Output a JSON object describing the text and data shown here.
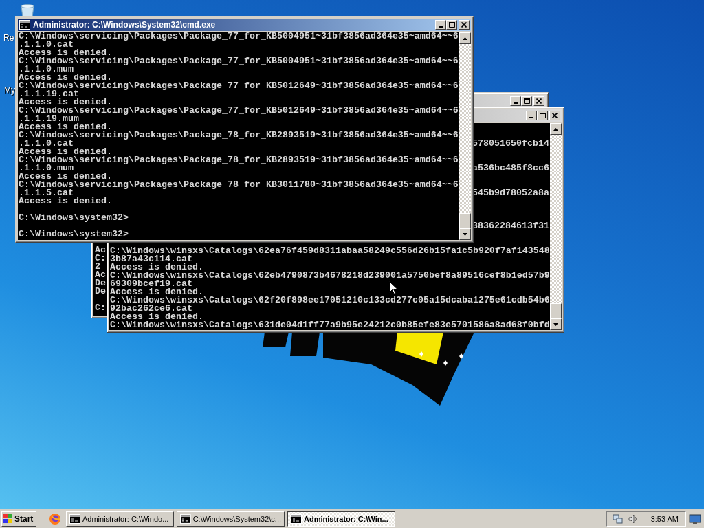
{
  "desktop": {
    "icons": [
      {
        "kind": "recycle_bin",
        "label": "Re"
      },
      {
        "kind": "computer",
        "label": "My"
      }
    ]
  },
  "windows": [
    {
      "active": false,
      "lines": [
        {
          "kind": "text",
          "text": "Ac"
        },
        {
          "kind": "text",
          "text": "C:"
        },
        {
          "kind": "text",
          "text": "2_"
        },
        {
          "kind": "text",
          "text": "Ac"
        },
        {
          "kind": "text",
          "text": "De"
        },
        {
          "kind": "text",
          "text": "De"
        },
        {
          "kind": "blank"
        },
        {
          "kind": "text",
          "text": "C:"
        }
      ]
    },
    {
      "active": false,
      "fragments": [
        "578051650fcb14",
        "a536bc485f8cc6",
        "545b9d78052a8a",
        "38362284613f31"
      ],
      "lines": [
        {
          "kind": "text",
          "text": "C:\\Windows\\winsxs\\Catalogs\\62ea76f459d8311abaa58249c556d26b15fa1c5b920f7af143548"
        },
        {
          "kind": "text",
          "text": "3b87a43c114.cat"
        },
        {
          "kind": "text",
          "text": "Access is denied."
        },
        {
          "kind": "text",
          "text": "C:\\Windows\\winsxs\\Catalogs\\62eb4790873b4678218d239001a5750bef8a89516cef8b1ed57b9"
        },
        {
          "kind": "text",
          "text": "69309bcef19.cat"
        },
        {
          "kind": "text",
          "text": "Access is denied."
        },
        {
          "kind": "text",
          "text": "C:\\Windows\\winsxs\\Catalogs\\62f20f898ee17051210c133cd277c05a15dcaba1275e61cdb54b6"
        },
        {
          "kind": "text",
          "text": "92bac262ce6.cat"
        },
        {
          "kind": "text",
          "text": "Access is denied."
        },
        {
          "kind": "text",
          "text": "C:\\Windows\\winsxs\\Catalogs\\631de04d1ff77a9b95e24212c0b85efe83e5701586a8ad68f0bfd"
        }
      ]
    },
    {
      "active": true,
      "title": "Administrator: C:\\Windows\\System32\\cmd.exe",
      "lines": [
        {
          "kind": "text",
          "text": "C:\\Windows\\servicing\\Packages\\Package_77_for_KB5004951~31bf3856ad364e35~amd64~~6"
        },
        {
          "kind": "text",
          "text": ".1.1.0.cat"
        },
        {
          "kind": "text",
          "text": "Access is denied."
        },
        {
          "kind": "text",
          "text": "C:\\Windows\\servicing\\Packages\\Package_77_for_KB5004951~31bf3856ad364e35~amd64~~6"
        },
        {
          "kind": "text",
          "text": ".1.1.0.mum"
        },
        {
          "kind": "text",
          "text": "Access is denied."
        },
        {
          "kind": "text",
          "text": "C:\\Windows\\servicing\\Packages\\Package_77_for_KB5012649~31bf3856ad364e35~amd64~~6"
        },
        {
          "kind": "text",
          "text": ".1.1.19.cat"
        },
        {
          "kind": "text",
          "text": "Access is denied."
        },
        {
          "kind": "text",
          "text": "C:\\Windows\\servicing\\Packages\\Package_77_for_KB5012649~31bf3856ad364e35~amd64~~6"
        },
        {
          "kind": "text",
          "text": ".1.1.19.mum"
        },
        {
          "kind": "text",
          "text": "Access is denied."
        },
        {
          "kind": "text",
          "text": "C:\\Windows\\servicing\\Packages\\Package_78_for_KB2893519~31bf3856ad364e35~amd64~~6"
        },
        {
          "kind": "text",
          "text": ".1.1.0.cat"
        },
        {
          "kind": "text",
          "text": "Access is denied."
        },
        {
          "kind": "text",
          "text": "C:\\Windows\\servicing\\Packages\\Package_78_for_KB2893519~31bf3856ad364e35~amd64~~6"
        },
        {
          "kind": "text",
          "text": ".1.1.0.mum"
        },
        {
          "kind": "text",
          "text": "Access is denied."
        },
        {
          "kind": "text",
          "text": "C:\\Windows\\servicing\\Packages\\Package_78_for_KB3011780~31bf3856ad364e35~amd64~~6"
        },
        {
          "kind": "text",
          "text": ".1.1.5.cat"
        },
        {
          "kind": "text",
          "text": "Access is denied."
        },
        {
          "kind": "blank"
        },
        {
          "kind": "text",
          "text": "C:\\Windows\\system32>"
        },
        {
          "kind": "blank"
        },
        {
          "kind": "text",
          "text": "C:\\Windows\\system32>"
        }
      ]
    }
  ],
  "taskbar": {
    "start": "Start",
    "tasks": [
      {
        "label": "Administrator: C:\\Windo...",
        "selected": false
      },
      {
        "label": "C:\\Windows\\System32\\c...",
        "selected": false
      },
      {
        "label": "Administrator: C:\\Win...",
        "selected": true
      }
    ],
    "clock": "3:53 AM"
  }
}
